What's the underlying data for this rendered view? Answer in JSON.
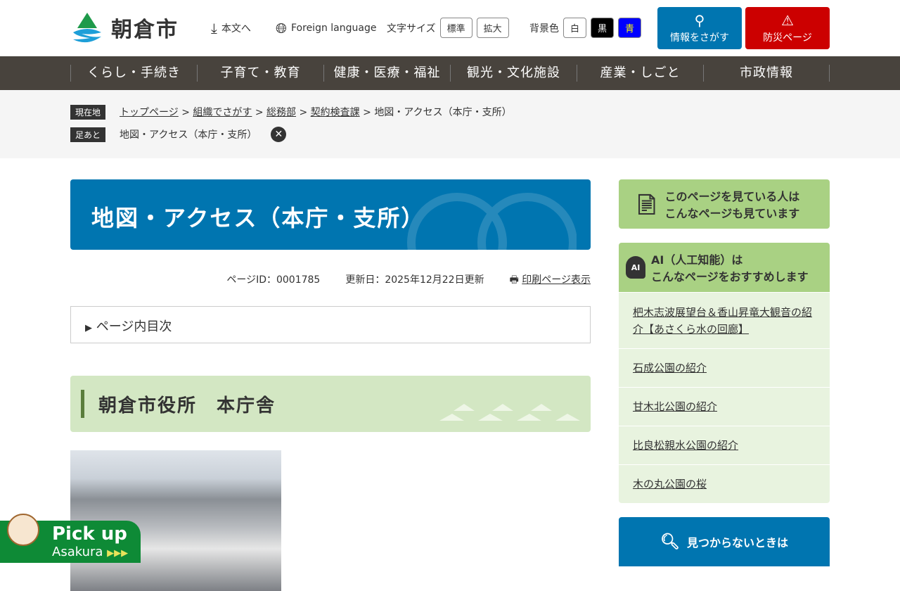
{
  "header": {
    "logo": "朝倉市",
    "skip": "本文へ",
    "foreign": "Foreign language",
    "font_size_label": "文字サイズ",
    "font_std": "標準",
    "font_large": "拡大",
    "bg_label": "背景色",
    "bg_white": "白",
    "bg_black": "黒",
    "bg_blue": "青",
    "search": "情報をさがす",
    "disaster": "防災ページ"
  },
  "gnav": [
    "くらし・手続き",
    "子育て・教育",
    "健康・医療・福祉",
    "観光・文化施設",
    "産業・しごと",
    "市政情報"
  ],
  "breadcrumb": {
    "label": "現在地",
    "items": [
      "トップページ",
      "組織でさがす",
      "総務部",
      "契約検査課"
    ],
    "current": "地図・アクセス（本庁・支所）",
    "sep": ">"
  },
  "footprint": {
    "label": "足あと",
    "item": "地図・アクセス（本庁・支所）"
  },
  "page": {
    "title": "地図・アクセス（本庁・支所）",
    "page_id": "ページID：0001785",
    "updated": "更新日：2025年12月22日更新",
    "print": "印刷ページ表示",
    "toc": "ページ内目次",
    "heading": "朝倉市役所　本庁舎"
  },
  "sidebar": {
    "viewed_line1": "このページを見ている人は",
    "viewed_line2": "こんなページも見ています",
    "ai_line1": "AI（人工知能）は",
    "ai_line2": "こんなページをおすすめします",
    "links": [
      "杷木志波展望台＆香山昇竜大観音の紹介【あさくら水の回廊】",
      "石成公園の紹介",
      "甘木北公園の紹介",
      "比良松親水公園の紹介",
      "木の丸公園の桜"
    ],
    "notfound": "見つからないときは"
  },
  "pickup": {
    "line1": "Pick up",
    "line2": "Asakura"
  }
}
